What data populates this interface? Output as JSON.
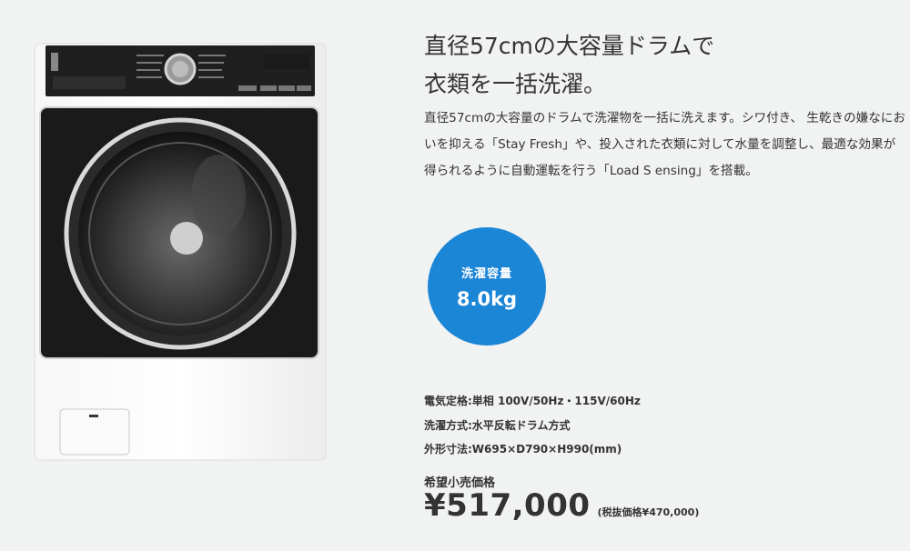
{
  "headline": {
    "line1": "直径57cmの大容量ドラムで",
    "line2": "衣類を一括洗濯。"
  },
  "description": "直径57cmの大容量のドラムで洗濯物を一括に洗えます。シワ付き、 生乾きの嫌なにおいを抑える「Stay Fresh」や、投入された衣類に対して水量を調整し、最適な効果が得られるように自動運転を行う「Load S ensing」を搭載。",
  "capacity": {
    "label": "洗濯容量",
    "value": "8.0kg"
  },
  "specs": [
    "電気定格:単相 100V/50Hz・115V/60Hz",
    "洗濯方式:水平反転ドラム方式",
    "外形寸法:W695×D790×H990(mm)"
  ],
  "price": {
    "label": "希望小売価格",
    "value": "¥517,000",
    "note": "(税抜価格¥470,000)"
  },
  "colors": {
    "background": "#f1f2f2",
    "badge": "#1b85d6",
    "text": "#333333"
  }
}
